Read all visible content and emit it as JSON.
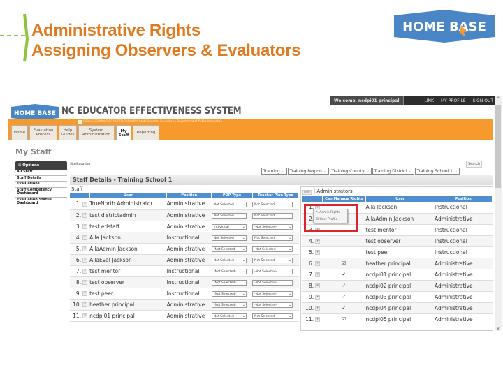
{
  "slide": {
    "title_line1": "Administrative Rights",
    "title_line2": "Assigning Observers & Evaluators",
    "logo_text": "HOME BASE",
    "colors": {
      "title": "#e07a1f",
      "accent_green": "#8cc63f",
      "logo_blue": "#4a86c5",
      "highlight_red": "#d9262c",
      "app_orange": "#f79a2e"
    }
  },
  "app": {
    "welcome": "Welcome, ncdpi01 principal",
    "links": [
      "LINK",
      "MY PROFILE",
      "SIGN OUT"
    ],
    "logo_text": "HOME BASE",
    "system_title": "NC EDUCATOR EFFECTIVENESS SYSTEM",
    "band_subtitle": "PUBLIC SCHOOLS OF NORTH CAROLINA  State Board of Education | Department of Public Instruction",
    "tabs": [
      {
        "label": "Home"
      },
      {
        "label": "Evaluation Process"
      },
      {
        "label": "Help Guides"
      },
      {
        "label": "System Administration"
      },
      {
        "label": "My Staff",
        "active": true
      },
      {
        "label": "Reporting"
      }
    ],
    "page_heading": "My Staff",
    "sidebar": {
      "options_label": "Options",
      "items": [
        "All Staff",
        "Staff Details",
        "Evaluations",
        "Staff Competency Dashboard",
        "Evaluation Status Dashboard"
      ]
    },
    "site_location_label": "Site/Location",
    "search_label": "Search",
    "filters": [
      "Training",
      "Training Region",
      "Training County",
      "Training District",
      "Training School 1"
    ],
    "details_header": "Staff Details - Training School 1",
    "staff_label": "Staff",
    "staff_table": {
      "columns": [
        "",
        "",
        "User",
        "Position",
        "PDP Type",
        "Teacher Plan Type"
      ],
      "rows": [
        {
          "n": "1.",
          "user": "TrueNorth Administrator",
          "position": "Administrative",
          "pdp": "Not Selected",
          "plan": "Not Selected"
        },
        {
          "n": "2.",
          "user": "test districtadmin",
          "position": "Administrative",
          "pdp": "Not Selected",
          "plan": "Not Selected"
        },
        {
          "n": "3.",
          "user": "test edstaff",
          "position": "Administrative",
          "pdp": "Individual",
          "plan": "-Not Selected-"
        },
        {
          "n": "4.",
          "user": "Alla Jackson",
          "position": "Instructional",
          "pdp": "Not Selected",
          "plan": "Not Selected"
        },
        {
          "n": "5.",
          "user": "AllaAdmin Jackson",
          "position": "Administrative",
          "pdp": "-Not Selected-",
          "plan": "-Not Selected-"
        },
        {
          "n": "6.",
          "user": "AllaEval Jackson",
          "position": "Administrative",
          "pdp": "Not Selected",
          "plan": "Not Selected"
        },
        {
          "n": "7.",
          "user": "test mentor",
          "position": "Instructional",
          "pdp": "-Not Selected-",
          "plan": "-Not Selected-"
        },
        {
          "n": "8.",
          "user": "test observer",
          "position": "Instructional",
          "pdp": "-Not Selected-",
          "plan": "-Not Selected-"
        },
        {
          "n": "9.",
          "user": "test peer",
          "position": "Instructional",
          "pdp": "-Not Selected-",
          "plan": "-Not Selected-"
        },
        {
          "n": "10.",
          "user": "heather principal",
          "position": "Administrative",
          "pdp": "-Not Selected-",
          "plan": "-Not Selected-"
        },
        {
          "n": "11.",
          "user": "ncdpi01 principal",
          "position": "Administrative",
          "pdp": "Not Selected",
          "plan": "Not Selected"
        }
      ]
    },
    "admins": {
      "add_label": "Add",
      "title": "Administrators",
      "columns": [
        "",
        "Can Manage Rights",
        "User",
        "Position"
      ],
      "rows": [
        {
          "n": "1.",
          "can_manage": "",
          "user": "Alla Jackson",
          "position": "Instructional"
        },
        {
          "n": "2.",
          "can_manage": "",
          "user": "AllaAdmin Jackson",
          "position": "Administrative"
        },
        {
          "n": "3.",
          "can_manage": "",
          "user": "test mentor",
          "position": "Instructional"
        },
        {
          "n": "4.",
          "can_manage": "",
          "user": "test observer",
          "position": "Instructional"
        },
        {
          "n": "5.",
          "can_manage": "",
          "user": "test peer",
          "position": "Instructional"
        },
        {
          "n": "6.",
          "can_manage": "☑",
          "user": "heather principal",
          "position": "Administrative"
        },
        {
          "n": "7.",
          "can_manage": "✓",
          "user": "ncdpi01 principal",
          "position": "Administrative"
        },
        {
          "n": "8.",
          "can_manage": "✓",
          "user": "ncdpi02 principal",
          "position": "Administrative"
        },
        {
          "n": "9.",
          "can_manage": "✓",
          "user": "ncdpi03 principal",
          "position": "Administrative"
        },
        {
          "n": "10.",
          "can_manage": "✓",
          "user": "ncdpi04 principal",
          "position": "Administrative"
        },
        {
          "n": "11.",
          "can_manage": "☑",
          "user": "ncdpi05 principal",
          "position": "Administrative"
        }
      ],
      "popup_items": [
        "Admin Rights",
        "User Profile"
      ]
    }
  }
}
